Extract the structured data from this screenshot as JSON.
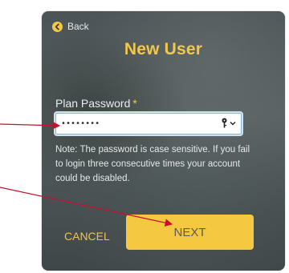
{
  "dialog": {
    "back_label": "Back",
    "title": "New User",
    "password_label": "Plan Password",
    "required_marker": "*",
    "password_value": "••••••••",
    "note": "Note: The password is case sensitive. If you fail to login three consecutive times your account could be disabled.",
    "cancel_label": "CANCEL",
    "next_label": "NEXT"
  },
  "colors": {
    "accent": "#f5c842",
    "annotation_arrow": "#c8102e",
    "input_focus": "#8fb6d9"
  },
  "icons": {
    "back": "arrow-left-circle-icon",
    "key": "key-icon",
    "dropdown": "chevron-down-icon"
  }
}
